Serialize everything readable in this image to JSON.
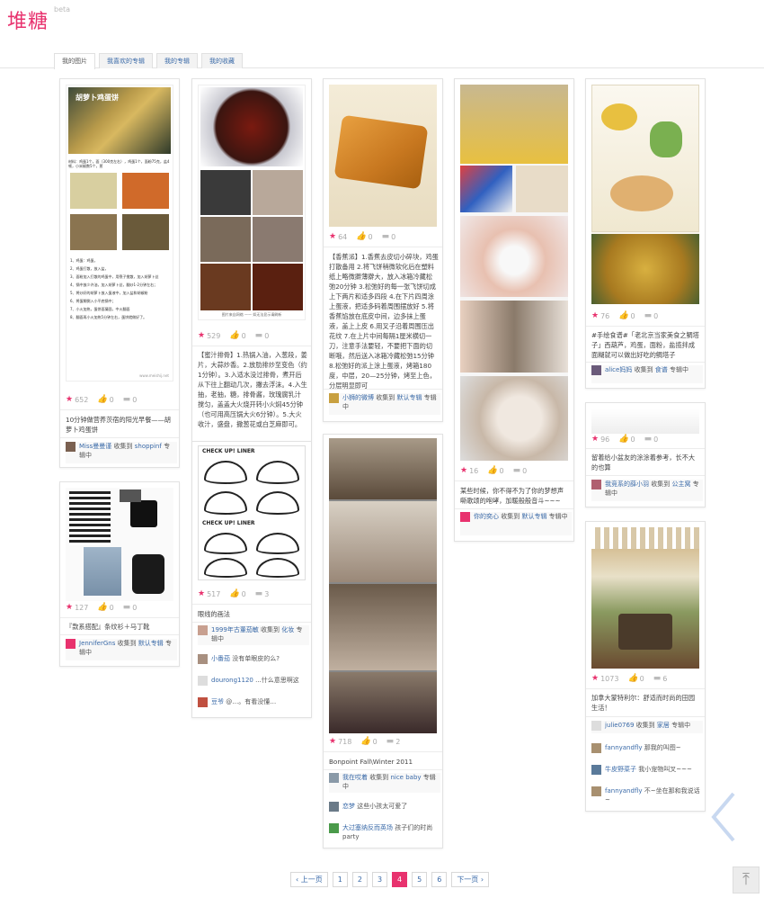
{
  "header": {
    "logo": "堆糖",
    "beta": "beta"
  },
  "tabs": [
    "我的图片",
    "我喜欢的专辑",
    "我的专辑",
    "我的收藏"
  ],
  "cards": [
    {
      "stats": {
        "likes": "652",
        "thumbs": "0",
        "comments": "0"
      },
      "desc": "10分钟做营养茨宿的阳光早餐——胡萝卜鸡蛋饼",
      "foot": [
        {
          "user": "Miss曼曼谨",
          "action": " 收集到 ",
          "album": "shoppinf",
          "suffix": " 专辑中"
        }
      ]
    },
    {
      "stats": {
        "likes": "127",
        "thumbs": "0",
        "comments": "0"
      },
      "desc": "『款系搭配』条纹衫＋马丁靴",
      "foot": [
        {
          "user": "JenniferGns",
          "action": " 收集到 ",
          "album": "默认专辑",
          "suffix": " 专辑中"
        }
      ]
    },
    {
      "stats": {
        "likes": "529",
        "thumbs": "0",
        "comments": "0"
      },
      "desc": "【蜜汁排骨】1.热锅入油，入葱段，姜片，大蒜炒香。2.放肋排炒至变色（约1分钟）。3.入适水没过排骨，煮开后从下往上翻动几次，撇去浮沫。4.入生抽，老抽，糖，排骨酱，玫瑰腐乳汁搅匀，盖盖大火烧开转小火焖45分钟（也可用高压锅大火6分钟）。5.大火收汁，盛盘，撒葱花或白芝麻即可。"
    },
    {
      "stats": {
        "likes": "517",
        "thumbs": "0",
        "comments": "3"
      },
      "desc": "眼线的画法",
      "foot": [
        {
          "user": "1999年古董茄敏",
          "action": " 收集到 ",
          "album": "化妆",
          "suffix": " 专辑中"
        },
        {
          "user": "小番茄",
          "action": "  没有单眼皮的么?",
          "album": "",
          "suffix": ""
        },
        {
          "user": "dourong1120",
          "action": " ...什么意思啊这",
          "album": "",
          "suffix": ""
        },
        {
          "user": "豆爷",
          "action": " @…。有看没懂…",
          "album": "",
          "suffix": ""
        }
      ]
    },
    {
      "stats": {
        "likes": "64",
        "thumbs": "0",
        "comments": "0"
      },
      "desc": "【香蕉派】1.香蕉去皮切小碎块，鸡蛋打散备用 2.将飞饼稍微软化后在塑料纸上略微擀薄擀大，放入冰箱冷藏松弛20分钟 3.松弛好的每一张飞饼切成上下两片和适多四段 4.在下片四周涂上蛋液，把适多码着周围摆放好 5.将香蕉馅放在底皮中间，边多抹上蛋液，盖上上皮 6.用叉子沿着周围压出花纹 7.在上片中间每隔1厘米横切一刀，注意手法要轻，不要把下面的切断哦，然后送入冰箱冷藏松弛15分钟 8.松弛好的派上涂上蛋液，烤箱180度，中层，20—25分钟，烤至上色，分层明显即可",
      "foot": [
        {
          "user": "小狮的微博",
          "action": " 收集到 ",
          "album": "默认专辑",
          "suffix": " 专辑中"
        }
      ]
    },
    {
      "stats": {
        "likes": "718",
        "thumbs": "0",
        "comments": "2"
      },
      "desc": "Bonpoint Fall\\Winter 2011",
      "foot": [
        {
          "user": "我在哎着",
          "action": " 收集到 ",
          "album": "nice baby",
          "suffix": " 专辑中"
        },
        {
          "user": "恋梦",
          "action": " 这些小孩太可爱了",
          "album": "",
          "suffix": ""
        },
        {
          "user": "大过塞纳反而英场",
          "action": " 孩子们的时尚party",
          "album": "",
          "suffix": ""
        }
      ]
    },
    {
      "stats": {
        "likes": "16",
        "thumbs": "0",
        "comments": "0"
      },
      "desc": "某些时候，你不得不为了你的梦想声嘶歌颂的咆哮，加暖般般音斗~~~",
      "foot": [
        {
          "user": "你的奕心",
          "action": " 收集到 ",
          "album": "默认专辑",
          "suffix": " 专辑中"
        }
      ]
    },
    {
      "stats": {
        "likes": "76",
        "thumbs": "0",
        "comments": "0"
      },
      "desc": "#手绘食谱#「老北京当家美食之鲷塔子」西葫芦，鸡蛋，面粉，盐揽拌成面糊就可以做出好吃的鲷塔子",
      "foot": [
        {
          "user": "alice妈妈",
          "action": " 收集到 ",
          "album": "食谱",
          "suffix": " 专辑中"
        }
      ]
    },
    {
      "stats": {
        "likes": "96",
        "thumbs": "0",
        "comments": "0"
      },
      "desc": "留着给小盆友的涂涂着参考，长不大的也算",
      "foot": [
        {
          "user": "我竞系的薛小羽",
          "action": " 收集到 ",
          "album": "公主窝",
          "suffix": " 专辑中"
        }
      ]
    },
    {
      "stats": {
        "likes": "1073",
        "thumbs": "0",
        "comments": "6"
      },
      "desc": "加拿大蒙特利尔：舒适而时尚的田园生活！",
      "foot": [
        {
          "user": "julie0769",
          "action": " 收集到 ",
          "album": "家居",
          "suffix": " 专辑中"
        },
        {
          "user": "fannyandfly",
          "action": " 那我的叫图~",
          "album": "",
          "suffix": ""
        },
        {
          "user": "牛皮野菜子",
          "action": " 我小宠物叫叉~~~",
          "album": "",
          "suffix": ""
        },
        {
          "user": "fannyandfly",
          "action": " 不~坐在那和我说话~",
          "album": "",
          "suffix": ""
        }
      ]
    }
  ],
  "recipe_card": {
    "title": "胡萝卜鸡蛋饼",
    "lines": [
      "材料：鸡蛋1个，面（300克左右），鸡蛋1个，面粉75克，盐4顿，小米椒数5个，葱",
      "1、鸡蛋：鸡蛋，",
      "2、鸡蛋打散，放入盐，",
      "3、面粉加入打散的鸡蛋中，用筷子搅散，加入胡萝卜丝",
      "4、锅中放少许油，加入胡萝卜丝，翻炒1-2分钟左右；",
      "5、将炒好的胡萝卜放入蛋液中，加入盐和胡椒粉",
      "6、将蛋糊倒入小平底锅中；",
      "7、小火加热，蛋饼面凝固，中火翻面",
      "8、翻面再小火加热5分钟左右，蛋饼就做好了。"
    ],
    "url": "www.meishij.net"
  },
  "dish_caption": "图片来自网络 —— 如无法显示请刷新",
  "eyeliner_title": "CHECK UP! LINER",
  "pager": {
    "prev": "‹ 上一页",
    "pages": [
      "1",
      "2",
      "3",
      "4",
      "5",
      "6"
    ],
    "current": "4",
    "next": "下一页 ›"
  },
  "colors": {
    "brand": "#e8326e",
    "link": "#3a6aa8"
  }
}
